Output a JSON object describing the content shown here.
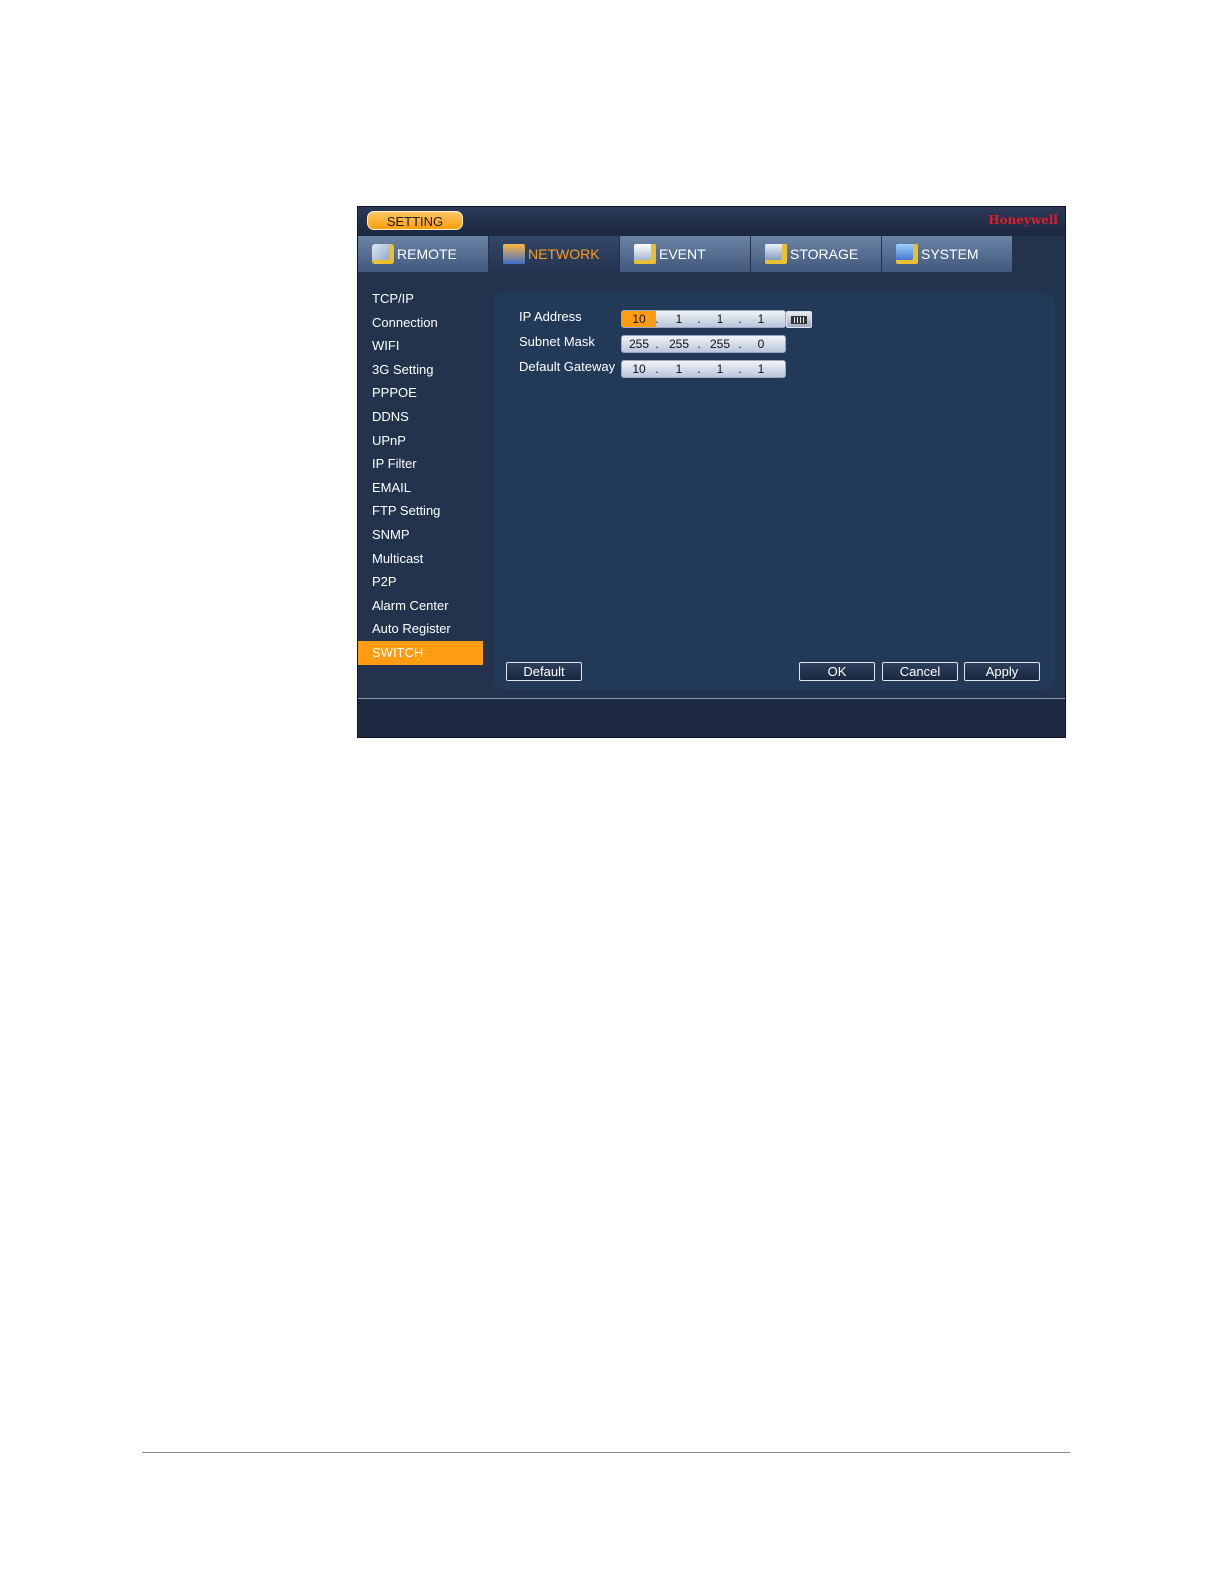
{
  "header": {
    "setting_label": "SETTING",
    "brand": "Honeywell"
  },
  "tabs": [
    {
      "label": "REMOTE",
      "icon": "remote-settings-icon"
    },
    {
      "label": "NETWORK",
      "icon": "network-icon",
      "active": true
    },
    {
      "label": "EVENT",
      "icon": "event-icon"
    },
    {
      "label": "STORAGE",
      "icon": "storage-icon"
    },
    {
      "label": "SYSTEM",
      "icon": "system-icon"
    }
  ],
  "sidebar": {
    "items": [
      {
        "label": "TCP/IP"
      },
      {
        "label": "Connection"
      },
      {
        "label": "WIFI"
      },
      {
        "label": "3G Setting"
      },
      {
        "label": "PPPOE"
      },
      {
        "label": "DDNS"
      },
      {
        "label": "UPnP"
      },
      {
        "label": "IP Filter"
      },
      {
        "label": "EMAIL"
      },
      {
        "label": "FTP Setting"
      },
      {
        "label": "SNMP"
      },
      {
        "label": "Multicast"
      },
      {
        "label": "P2P"
      },
      {
        "label": "Alarm Center"
      },
      {
        "label": "Auto Register"
      },
      {
        "label": "SWITCH",
        "active": true
      }
    ]
  },
  "form": {
    "ip_address": {
      "label": "IP Address",
      "octets": [
        "10",
        "1",
        "1",
        "1"
      ]
    },
    "subnet_mask": {
      "label": "Subnet Mask",
      "octets": [
        "255",
        "255",
        "255",
        "0"
      ]
    },
    "default_gateway": {
      "label": "Default Gateway",
      "octets": [
        "10",
        "1",
        "1",
        "1"
      ]
    }
  },
  "buttons": {
    "default": "Default",
    "ok": "OK",
    "cancel": "Cancel",
    "apply": "Apply"
  },
  "colors": {
    "accent": "#ff9c12",
    "background": "#23334d",
    "panel": "#223a57",
    "brand": "#e01d2d"
  }
}
